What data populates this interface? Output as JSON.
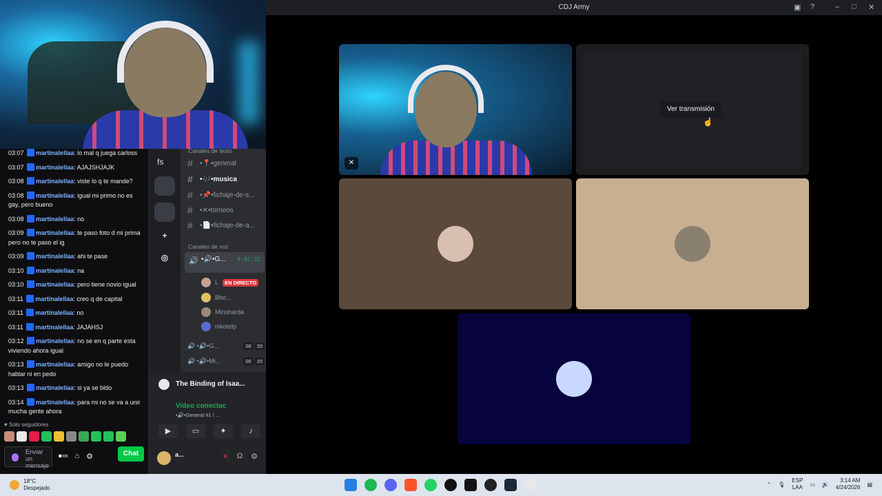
{
  "window": {
    "title": "CDJ Army"
  },
  "chat": {
    "messages": [
      {
        "time": "03:07",
        "user": "martinalellaa",
        "text": "lo mal q juega carloss"
      },
      {
        "time": "03:07",
        "user": "martinalellaa",
        "text": "AJAJSHJAJK"
      },
      {
        "time": "03:08",
        "user": "martinalellaa",
        "text": "viste lo q te mande?"
      },
      {
        "time": "03:08",
        "user": "martinalellaa",
        "text": "igual mi primo no es gay, pero bueno"
      },
      {
        "time": "03:08",
        "user": "martinalellaa",
        "text": "no"
      },
      {
        "time": "03:09",
        "user": "martinalellaa",
        "text": "te paso foto d mi prima pero no te paso el ig"
      },
      {
        "time": "03:09",
        "user": "martinalellaa",
        "text": "ahi te pase"
      },
      {
        "time": "03:10",
        "user": "martinalellaa",
        "text": "na"
      },
      {
        "time": "03:10",
        "user": "martinalellaa",
        "text": "pero tiene novio igual"
      },
      {
        "time": "03:11",
        "user": "martinalellaa",
        "text": "creo q de capital"
      },
      {
        "time": "03:11",
        "user": "martinalellaa",
        "text": "no"
      },
      {
        "time": "03:11",
        "user": "martinalellaa",
        "text": "JAJAHSJ"
      },
      {
        "time": "03:12",
        "user": "martinalellaa",
        "text": "no se en q parte esta viviendo ahora igual"
      },
      {
        "time": "03:13",
        "user": "martinalellaa",
        "text": "amigo no le puedo hablar ni en pedo"
      },
      {
        "time": "03:13",
        "user": "martinalellaa",
        "text": "si ya se bldo"
      },
      {
        "time": "03:14",
        "user": "martinalellaa",
        "text": "para mi no se va a unir mucha gente ahora"
      }
    ],
    "followers_only": "Solo seguidores",
    "input_placeholder": "Enviar un mensaje",
    "send_label": "Chat"
  },
  "discord": {
    "server_abbrev": "fs",
    "text_category": "Canales de texto",
    "text_channels": [
      "•📍•general",
      "•🎶•musica",
      "•📌•fichaje-de-s...",
      "•✕•torneos",
      "•📄•fichaje-de-a..."
    ],
    "voice_category": "Canales de voz",
    "active_voice": {
      "name": "•🔊•G...",
      "timer": "6:02:31"
    },
    "voice_users": [
      {
        "name": "L",
        "live": "EN DIRECTO"
      },
      {
        "name": "Bbo..."
      },
      {
        "name": "Minsharda"
      },
      {
        "name": "nikotelp"
      }
    ],
    "other_voice": [
      {
        "name": "•🔊•G...",
        "a": "00",
        "b": "20"
      },
      {
        "name": "•🔊•Mi...",
        "a": "00",
        "b": "20"
      }
    ],
    "activity": "The Binding of Isaa...",
    "voice_status": "Video conectac",
    "voice_sub": "•🔊•General #1 / ...",
    "username": "a..."
  },
  "call": {
    "watch_stream": "Ver transmisión"
  },
  "taskbar": {
    "temp": "18°C",
    "weather": "Despejado",
    "lang1": "ESP",
    "lang2": "LAA",
    "time": "3:14 AM",
    "date": "4/24/2026"
  }
}
